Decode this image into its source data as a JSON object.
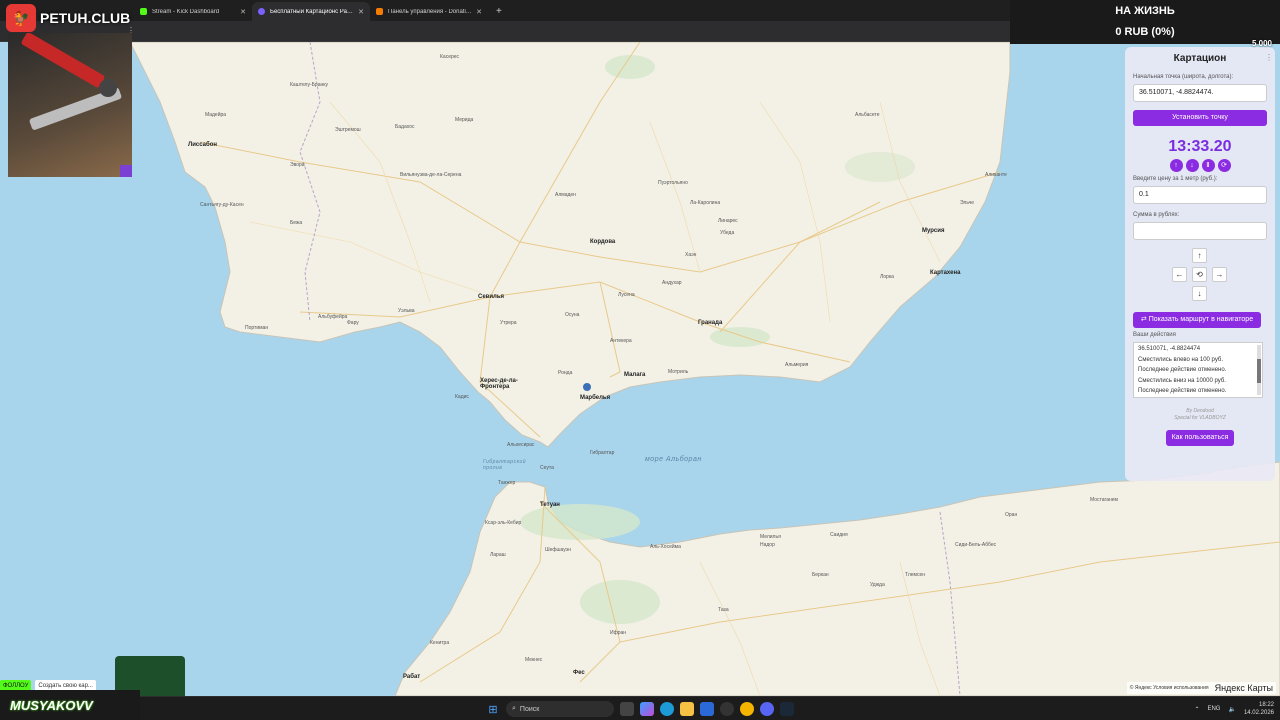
{
  "browser": {
    "tabs": [
      {
        "title": "Stream - Kick Dashboard",
        "color": "#53fc18",
        "active": false
      },
      {
        "title": "Бесплатный Картационс Расс...",
        "color": "#7b61ff",
        "active": true
      },
      {
        "title": "Панель управления - Donatio...",
        "color": "#f57c00",
        "active": false
      }
    ],
    "new_tab": "+",
    "controls": {
      "minimize": "–",
      "restore": "▢",
      "close": "✕"
    }
  },
  "overlay": {
    "brand": "PETUH.CLUB",
    "goal_title": "НА ЖИЗНЬ",
    "goal_amount": "0 RUB (0%)",
    "goal_target": "5 000",
    "streamer": "MUSYAKOVV",
    "chat_buttons": [
      "ФОЛЛОУ",
      "Создать свою кар..."
    ]
  },
  "panel": {
    "title": "Картацион",
    "start_label": "Начальная точка (широта, долгота):",
    "start_value": "36.510071, -4.8824474.",
    "set_point_button": "Установить точку",
    "timer": "13:33.20",
    "timer_controls": [
      "↑",
      "↓",
      "Ⅱ",
      "⟳"
    ],
    "price_label": "Введите цену за 1 метр (руб.):",
    "price_value": "0.1",
    "sum_label": "Сумма в рублях:",
    "sum_value": "",
    "dpad": {
      "up": "↑",
      "left": "←",
      "reset": "⟲",
      "right": "→",
      "down": "↓"
    },
    "navigator_button": "Показать маршрут в навигаторе",
    "actions_label": "Ваши действия",
    "actions_log": [
      "36.510071, -4.8824474",
      "Сместились влево на 100 руб.",
      "Последнее действие отменено.",
      "Сместились вниз на 10000 руб.",
      "Последнее действие отменено."
    ],
    "credits_1": "By Dendood",
    "credits_2": "Special for VLADBOYZ",
    "how_button": "Как пользоваться"
  },
  "map": {
    "cities_major": [
      "Лиссабон",
      "Севилья",
      "Кордова",
      "Гранада",
      "Малага",
      "Мурсия",
      "Картахена",
      "Херес-де-ла-Фронтера",
      "Тетуан",
      "Фес",
      "Рабат",
      "Марбелья"
    ],
    "cities_minor": [
      "Каштелу-Бранку",
      "Касерес",
      "Мадейра",
      "Бадахос",
      "Мерида",
      "Эштремош",
      "Эвора",
      "Сантьягу-ду-Касен",
      "Бежа",
      "Уэльва",
      "Альбуфейра",
      "Портиман",
      "Фару",
      "Кадис",
      "Альхесирас",
      "Хаэн",
      "Альмерия",
      "Мотриль",
      "Антекера",
      "Ронда",
      "Линарес",
      "Убеда",
      "Лорка",
      "Альбасете",
      "Эльче",
      "Аликанте",
      "Танжер",
      "Лараш",
      "Кенитра",
      "Мекнес",
      "Надор",
      "Уджда",
      "Тлемсен",
      "Оран",
      "Мостаганем",
      "Сиди-Бель-Аббес",
      "Ксар-эль-Кебир",
      "Шефшауэн",
      "Аль-Хосейма",
      "Саидия",
      "Беркан",
      "Таза",
      "Ифран",
      "Гибралтар",
      "Сеута",
      "Мелилья",
      "Пуэртольяно",
      "Вильянуэва-де-ла-Серена",
      "Алмаден",
      "Андухар",
      "Лусена",
      "Осуна",
      "Утрера",
      "Ла-Каролина"
    ],
    "sea": "море Альборан",
    "strait": "Гибралтарский пролив",
    "attribution": "© Яндекс  Условия использования",
    "brand": "Яндекс Карты"
  },
  "taskbar": {
    "search": "Поиск",
    "lang": "ENG",
    "time": "18:22",
    "date": "14.02.2026"
  },
  "colors": {
    "accent": "#8b2be2",
    "sea": "#a9d5ec",
    "land": "#f1efe4"
  }
}
